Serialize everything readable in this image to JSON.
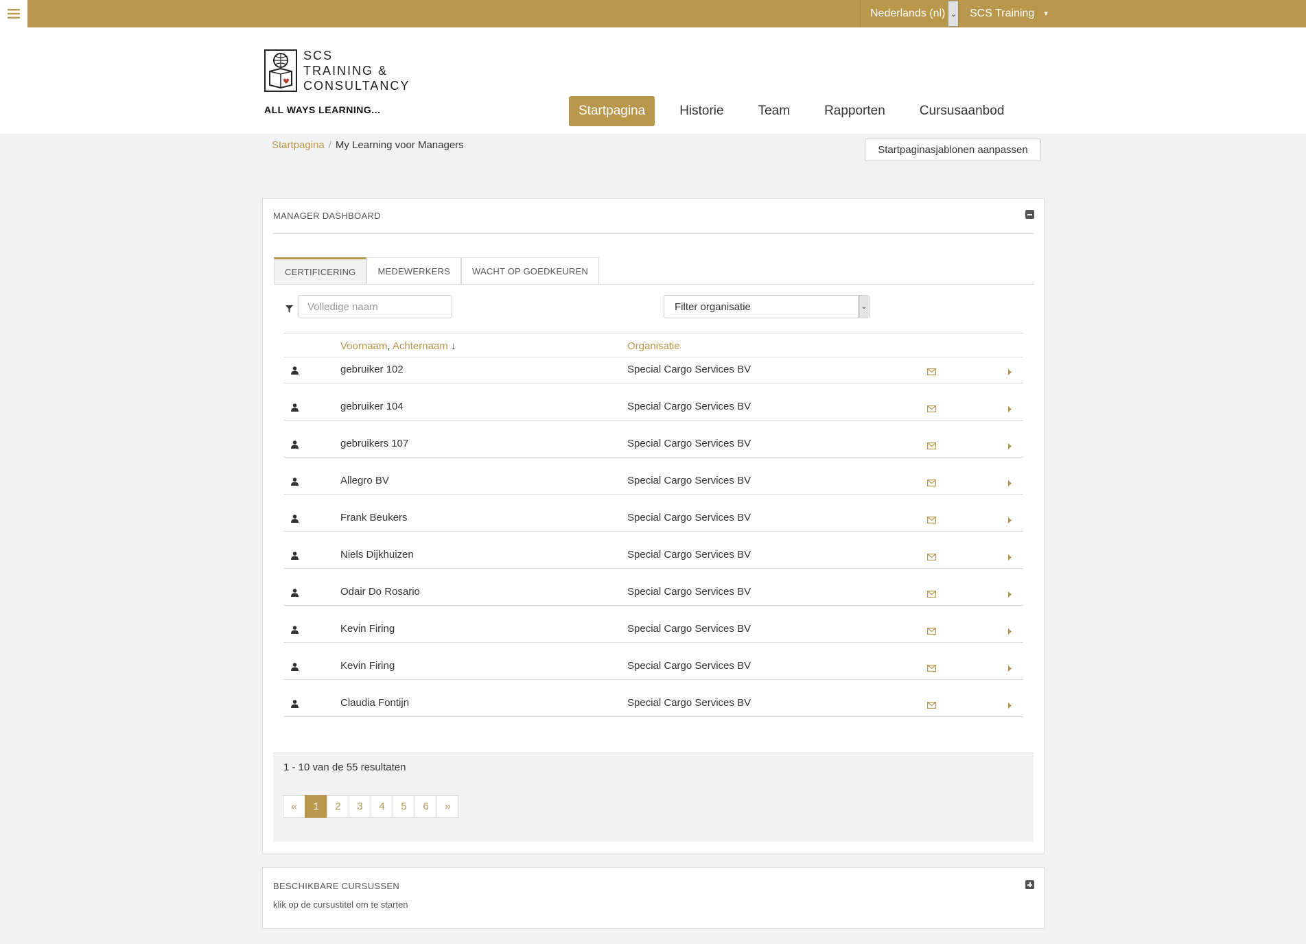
{
  "topbar": {
    "menu_icon": "hamburger-icon",
    "language": "Nederlands (nl)",
    "user": "SCS Training",
    "accent_color": "#b8964a"
  },
  "header": {
    "logo_line1": "SCS",
    "logo_line2": "TRAINING &",
    "logo_line3": "CONSULTANCY",
    "tagline": "ALL WAYS LEARNING...",
    "nav": [
      "Startpagina",
      "Historie",
      "Team",
      "Rapporten",
      "Cursusaanbod"
    ],
    "active_nav": "Startpagina"
  },
  "breadcrumb": {
    "home": "Startpagina",
    "current": "My Learning voor Managers"
  },
  "customize_button": "Startpaginasjablonen aanpassen",
  "dashboard": {
    "title": "MANAGER DASHBOARD",
    "tabs": [
      "CERTIFICERING",
      "MEDEWERKERS",
      "WACHT OP GOEDKEUREN"
    ],
    "active_tab": "CERTIFICERING",
    "name_placeholder": "Volledige naam",
    "org_filter": "Filter organisatie",
    "columns": {
      "first_name": "Voornaam",
      "comma": ",",
      "last_name": "Achternaam",
      "sort_indicator": "↓",
      "organisation": "Organisatie"
    },
    "rows": [
      {
        "name": "gebruiker 102",
        "org": "Special Cargo Services BV"
      },
      {
        "name": "gebruiker 104",
        "org": "Special Cargo Services BV"
      },
      {
        "name": "gebruikers 107",
        "org": "Special Cargo Services BV"
      },
      {
        "name": "Allegro BV",
        "org": "Special Cargo Services BV"
      },
      {
        "name": "Frank Beukers",
        "org": "Special Cargo Services BV"
      },
      {
        "name": "Niels Dijkhuizen",
        "org": "Special Cargo Services BV"
      },
      {
        "name": "Odair Do Rosario",
        "org": "Special Cargo Services BV"
      },
      {
        "name": "Kevin Firing",
        "org": "Special Cargo Services BV"
      },
      {
        "name": "Kevin Firing",
        "org": "Special Cargo Services BV"
      },
      {
        "name": "Claudia Fontijn",
        "org": "Special Cargo Services BV"
      }
    ],
    "results_text": "1 - 10 van de 55 resultaten",
    "pagination": [
      "«",
      "1",
      "2",
      "3",
      "4",
      "5",
      "6",
      "»"
    ],
    "active_page": "1"
  },
  "courses_panel": {
    "title": "BESCHIKBARE CURSUSSEN",
    "subtitle": "klik op de cursustitel om te starten"
  }
}
